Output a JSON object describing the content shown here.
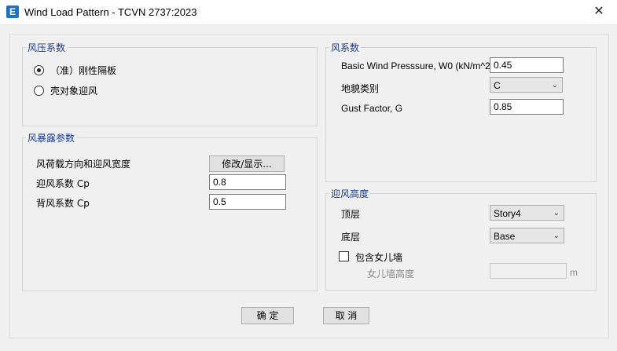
{
  "window": {
    "icon_letter": "E",
    "title": "Wind Load Pattern - TCVN 2737:2023",
    "close": "✕"
  },
  "pressure_group": {
    "title": "风压系数",
    "options": [
      {
        "label": "（准）刚性隔板",
        "selected": true
      },
      {
        "label": "壳对象迎风",
        "selected": false
      }
    ]
  },
  "exposure_group": {
    "title": "风暴露参数",
    "direction_label": "风荷载方向和迎风宽度",
    "modify_button": "修改/显示...",
    "windward_label": "迎风系数 Cp",
    "windward_value": "0.8",
    "leeward_label": "背风系数 Cp",
    "leeward_value": "0.5"
  },
  "wind_coeff_group": {
    "title": "风系数",
    "w0_label": "Basic Wind Presssure, W0 (kN/m^2)",
    "w0_value": "0.45",
    "terrain_label": "地貌类别",
    "terrain_value": "C",
    "gust_label": "Gust Factor, G",
    "gust_value": "0.85"
  },
  "height_group": {
    "title": "迎风高度",
    "top_label": "顶层",
    "top_value": "Story4",
    "bottom_label": "底层",
    "bottom_value": "Base",
    "parapet_label": "包含女儿墙",
    "parapet_checked": false,
    "parapet_height_label": "女儿墙高度",
    "parapet_height_value": "",
    "parapet_unit": "m"
  },
  "footer": {
    "ok": "确 定",
    "cancel": "取 消"
  }
}
